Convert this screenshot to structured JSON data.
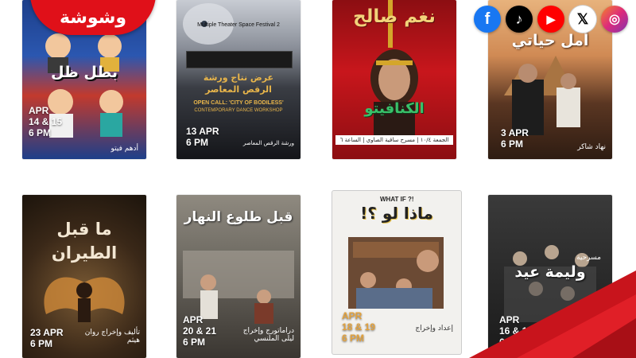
{
  "brand": {
    "logo_text": "وشوشة",
    "color": "#e01019"
  },
  "social": [
    {
      "name": "facebook",
      "glyph": "f",
      "color": "#1877f2"
    },
    {
      "name": "tiktok",
      "glyph": "♪",
      "color": "#000000"
    },
    {
      "name": "youtube",
      "glyph": "▶",
      "color": "#ff0000"
    },
    {
      "name": "x",
      "glyph": "𝕏",
      "color": "#000000"
    },
    {
      "name": "instagram",
      "glyph": "◎",
      "color": "#c13584"
    }
  ],
  "posters": [
    {
      "title": "بطل ظل",
      "date_line1": "APR",
      "date_line2": "14 & 15",
      "date_line3": "6 PM",
      "credit": "أدهم فيتو"
    },
    {
      "festival": "Multiple Theater Space Festival 2",
      "title": "عرض نتاج ورشة الرقص المعاصر",
      "open_call": "OPEN CALL: 'CITY OF BODILESS'",
      "subtitle": "CONTEMPORARY DANCE WORKSHOP",
      "date_line1": "13 APR",
      "date_line2": "6 PM",
      "credit": "ورشة الرقص المعاصر"
    },
    {
      "title": "نغم صالح",
      "subtitle": "الكنافيتو",
      "credit": "الجمعة ١٠/٤ | مسرح ساقية الصاوي | الساعة ٦"
    },
    {
      "title": "أمل حياتي",
      "date_line1": "3 APR",
      "date_line2": "6 PM",
      "credit": "نهاد شاكر"
    },
    {
      "title": "ما قبل الطيران",
      "date_line1": "23 APR",
      "date_line2": "6 PM",
      "credit": "تأليف وإخراج روان هيثم"
    },
    {
      "title": "قبل طلوع النهار",
      "date_line1": "APR",
      "date_line2": "20 & 21",
      "date_line3": "6 PM",
      "credit": "دراماتورج وإخراج ليلى الملنسي"
    },
    {
      "top": "WHAT IF ?!",
      "title": "ماذا لو ؟!",
      "date_line1": "APR",
      "date_line2": "18 & 19",
      "date_line3": "6 PM",
      "credit": "إعداد وإخراج"
    },
    {
      "title": "وليمة عيد",
      "date_line1": "APR",
      "date_line2": "16 & 1",
      "date_line3": "6 PM",
      "credit": "مسرحية"
    }
  ]
}
